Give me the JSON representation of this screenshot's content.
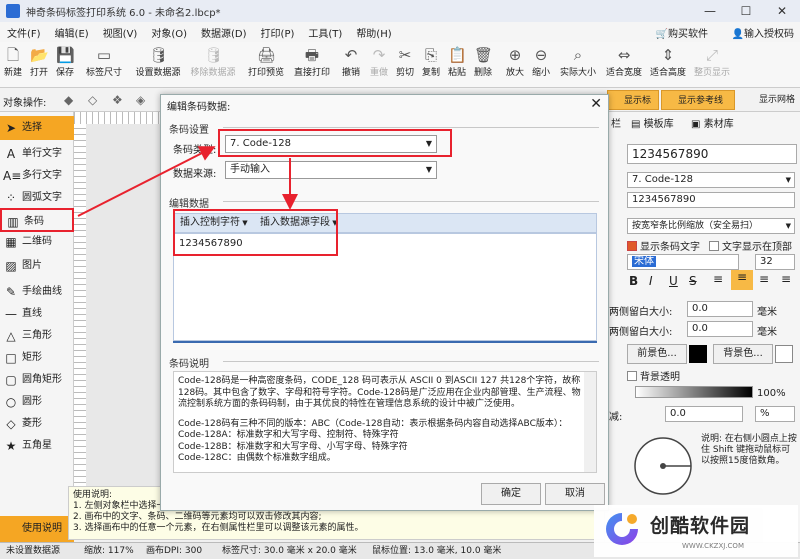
{
  "window": {
    "title": "神奇条码标签打印系统 6.0 - 未命名2.lbcp*",
    "min": "—",
    "max": "☐",
    "close": "✕"
  },
  "menu": {
    "items": [
      "文件(F)",
      "编辑(E)",
      "视图(V)",
      "对象(O)",
      "数据源(D)",
      "打印(P)",
      "工具(T)",
      "帮助(H)"
    ],
    "buy": "购买软件",
    "license": "输入授权码"
  },
  "toolbar": {
    "items": [
      {
        "label": "新建",
        "icon": "new-file-icon",
        "glyph": "🗋",
        "enabled": true
      },
      {
        "label": "打开",
        "icon": "open-icon",
        "glyph": "📂",
        "enabled": true
      },
      {
        "label": "保存",
        "icon": "save-icon",
        "glyph": "💾",
        "enabled": true
      },
      {
        "label": "标签尺寸",
        "icon": "label-size-icon",
        "glyph": "▭",
        "enabled": true
      },
      {
        "label": "设置数据源",
        "icon": "datasource-icon",
        "glyph": "🛢",
        "enabled": true
      },
      {
        "label": "移除数据源",
        "icon": "remove-datasource-icon",
        "glyph": "🛢",
        "enabled": false
      },
      {
        "label": "打印预览",
        "icon": "print-preview-icon",
        "glyph": "🖨",
        "enabled": true
      },
      {
        "label": "直接打印",
        "icon": "print-icon",
        "glyph": "🖶",
        "enabled": true
      },
      {
        "label": "撤销",
        "icon": "undo-icon",
        "glyph": "↶",
        "enabled": true
      },
      {
        "label": "重做",
        "icon": "redo-icon",
        "glyph": "↷",
        "enabled": false
      },
      {
        "label": "剪切",
        "icon": "cut-icon",
        "glyph": "✂",
        "enabled": true
      },
      {
        "label": "复制",
        "icon": "copy-icon",
        "glyph": "⎘",
        "enabled": true
      },
      {
        "label": "粘贴",
        "icon": "paste-icon",
        "glyph": "📋",
        "enabled": true
      },
      {
        "label": "删除",
        "icon": "delete-icon",
        "glyph": "🗑",
        "enabled": true
      },
      {
        "label": "放大",
        "icon": "zoom-in-icon",
        "glyph": "⊕",
        "enabled": true
      },
      {
        "label": "缩小",
        "icon": "zoom-out-icon",
        "glyph": "⊖",
        "enabled": true
      },
      {
        "label": "实际大小",
        "icon": "actual-size-icon",
        "glyph": "⌕",
        "enabled": true
      },
      {
        "label": "适合宽度",
        "icon": "fit-width-icon",
        "glyph": "⇔",
        "enabled": true
      },
      {
        "label": "适合高度",
        "icon": "fit-height-icon",
        "glyph": "⇕",
        "enabled": true
      },
      {
        "label": "整页显示",
        "icon": "fit-page-icon",
        "glyph": "⤢",
        "enabled": false
      }
    ]
  },
  "objrow": {
    "label": "对象操作:",
    "ruler": "显示标尺",
    "guide": "显示参考线",
    "grid": "显示网格"
  },
  "palette": {
    "items": [
      "选择",
      "单行文字",
      "多行文字",
      "圆弧文字",
      "条码",
      "二维码",
      "图片",
      "手绘曲线",
      "直线",
      "三角形",
      "矩形",
      "圆角矩形",
      "圆形",
      "菱形",
      "五角星"
    ],
    "help": "使用说明"
  },
  "help_text": [
    "使用说明:",
    "1. 左侧对象栏中选择一个对象，然后在画布上单击或拖拽绘制",
    "2. 画布中的文字、条码、二维码等元素均可以双击修改其内容;",
    "3. 选择画布中的任意一个元素，在右侧属性栏里可以调整该元素的属性。"
  ],
  "right_panel": {
    "tabs": [
      "栏",
      "模板库",
      "素材库"
    ],
    "content_value": "1234567890",
    "type_value": "7. Code-128",
    "data_value": "1234567890",
    "scale_value": "按宽窄条比例缩放（安全易扫）",
    "show_text": "显示条码文字",
    "text_top": "文字显示在顶部",
    "font": "宋体",
    "font_size": "32",
    "margin_lr_label": "两侧留白大小:",
    "margin_lr_value": "0.0",
    "margin_tb_label": "两侧留白大小:",
    "margin_tb_value": "0.0",
    "unit": "毫米",
    "fg_color": "前景色...",
    "bg_color": "背景色...",
    "transparent": "背景透明",
    "opacity": "100%",
    "reduce_label": "减:",
    "reduce_value": "0.0",
    "reduce_unit": "%",
    "note": "说明: 在右侧小圆点上按住 Shift 键拖动鼠标可以按照15度倍数角。"
  },
  "dialog": {
    "title": "编辑条码数据:",
    "close": "✕",
    "section_settings": "条码设置",
    "type_label": "条码类型:",
    "type_value": "7. Code-128",
    "source_label": "数据来源:",
    "source_value": "手动输入",
    "section_edit": "编辑数据",
    "insert_control": "插入控制字符",
    "insert_field": "插入数据源字段",
    "data_value": "1234567890",
    "section_desc": "条码说明",
    "desc": [
      "Code-128码是一种高密度条码，CODE_128 码可表示从 ASCII 0 到ASCII 127 共128个字符，故称128码。其中包含了数字、字母和符号字符。Code-128码是广泛应用在企业内部管理、生产流程、物流控制系统方面的条码码制，由于其优良的特性在管理信息系统的设计中被广泛使用。",
      "",
      "Code-128码有三种不同的版本：ABC（Code-128自动：表示根据条码内容自动选择ABC版本）：",
      "Code-128A：标准数字和大写字母、控制符、特殊字符",
      "Code-128B：标准数字和大写字母、小写字母、特殊字符",
      "Code-128C：由偶数个标准数字组成。"
    ],
    "ok": "确定",
    "cancel": "取消"
  },
  "status": {
    "items": [
      "未设置数据源",
      "缩放: 117%",
      "画布DPI: 300",
      "标签尺寸: 30.0 毫米 x 20.0 毫米",
      "鼠标位置: 13.0 毫米, 10.0 毫米"
    ]
  },
  "watermark": {
    "text": "创酷软件园",
    "url": "WWW.CKZXJ.COM"
  },
  "colors": {
    "accent": "#f5a623",
    "highlight": "#e8222e",
    "primary": "#2b6cd4"
  }
}
